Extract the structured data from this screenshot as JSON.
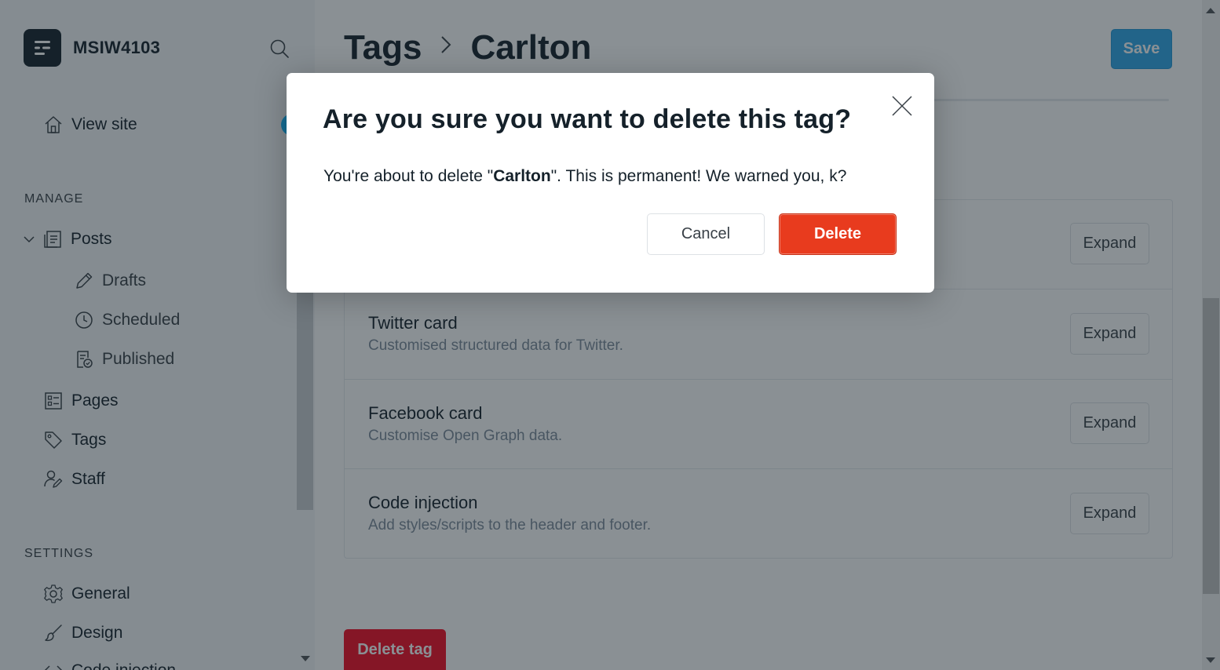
{
  "brand": {
    "name": "MSIW4103"
  },
  "sidebar": {
    "view_site": "View site",
    "manage_label": "MANAGE",
    "posts": "Posts",
    "drafts": "Drafts",
    "scheduled": "Scheduled",
    "published": "Published",
    "pages": "Pages",
    "tags": "Tags",
    "staff": "Staff",
    "settings_label": "SETTINGS",
    "general": "General",
    "design": "Design",
    "code_injection_partial": "Code injection"
  },
  "header": {
    "crumb_parent": "Tags",
    "crumb_current": "Carlton",
    "save_label": "Save"
  },
  "panel": {
    "rows": [
      {
        "title": "",
        "desc": "",
        "expand": "Expand"
      },
      {
        "title": "Twitter card",
        "desc": "Customised structured data for Twitter.",
        "expand": "Expand"
      },
      {
        "title": "Facebook card",
        "desc": "Customise Open Graph data.",
        "expand": "Expand"
      },
      {
        "title": "Code injection",
        "desc": "Add styles/scripts to the header and footer.",
        "expand": "Expand"
      }
    ]
  },
  "delete_tag_label": "Delete tag",
  "modal": {
    "title": "Are you sure you want to delete this tag?",
    "body_prefix": "You're about to delete \"",
    "body_name": "Carlton",
    "body_suffix": "\". This is permanent! We warned you, k?",
    "cancel_label": "Cancel",
    "delete_label": "Delete"
  },
  "colors": {
    "primary": "#2ea6e8",
    "danger": "#e83b1e",
    "overlay": "rgba(21,33,42,0.5)"
  }
}
